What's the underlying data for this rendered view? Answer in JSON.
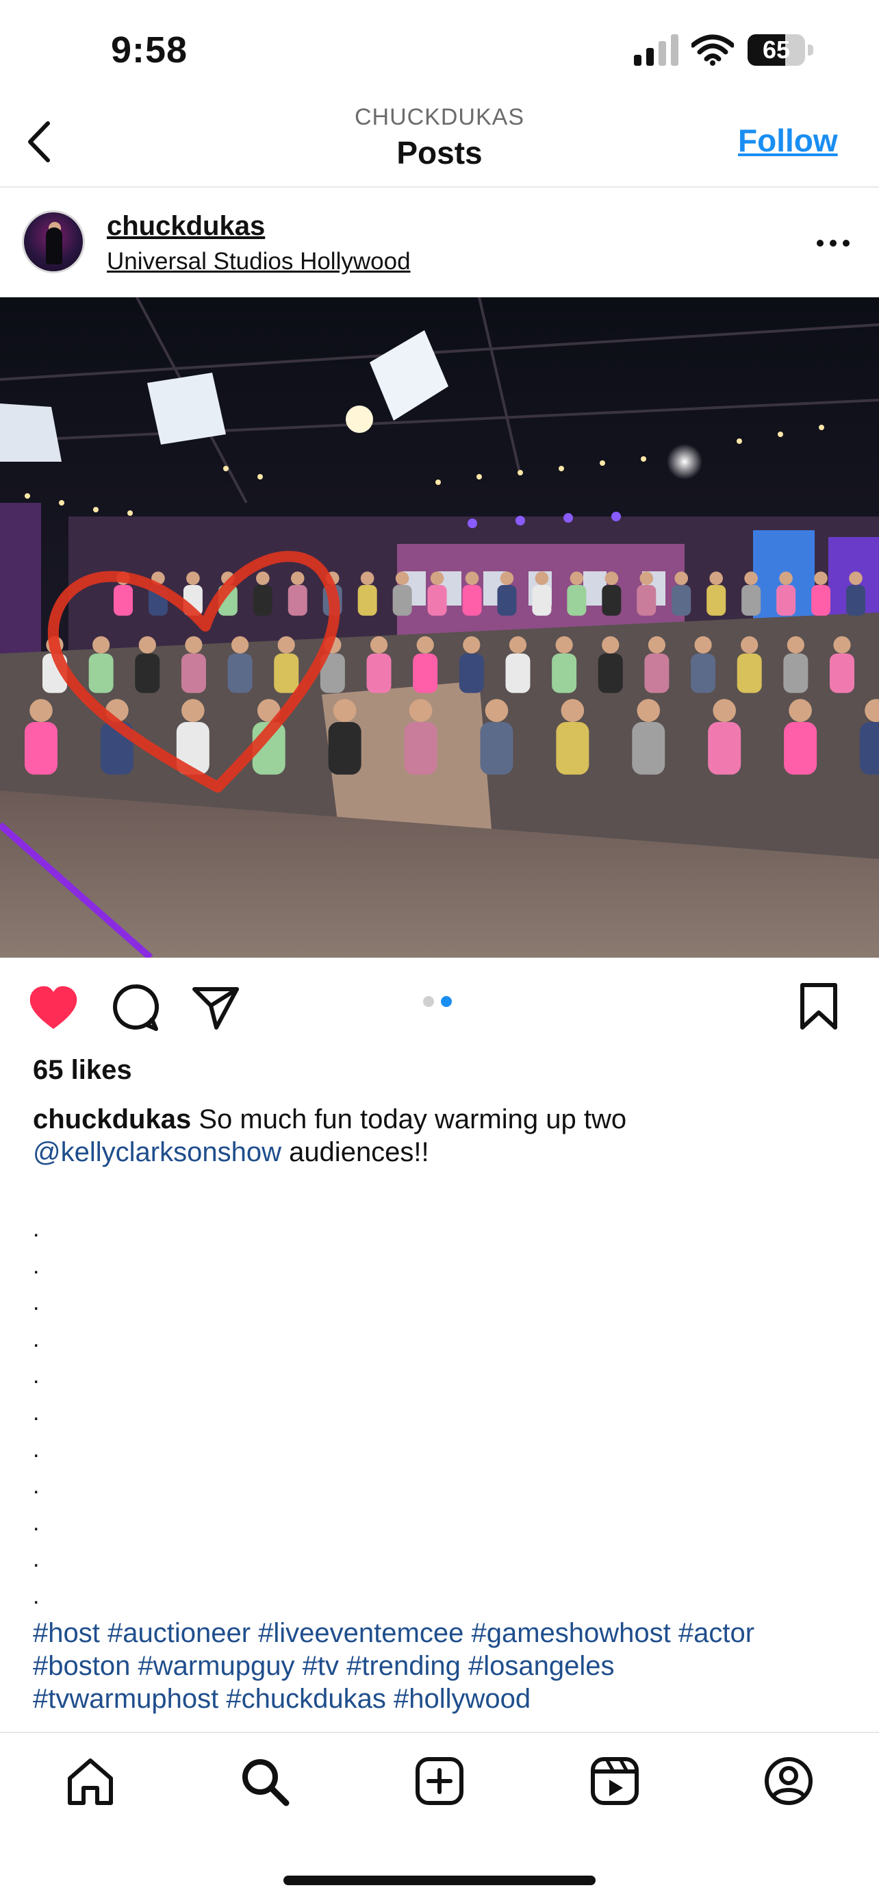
{
  "status": {
    "time": "9:58",
    "battery": "65",
    "battery_level": 0.65
  },
  "header": {
    "username": "CHUCKDUKAS",
    "title": "Posts",
    "follow_label": "Follow"
  },
  "post": {
    "username": "chuckdukas",
    "location": "Universal Studios Hollywood",
    "likes": "65 likes",
    "caption_user": "chuckdukas",
    "caption_text": " So much fun today warming up two",
    "mention": "@kellyclarksonshow",
    "caption_after": " audiences!!",
    "periods": [
      ".",
      ".",
      ".",
      ".",
      ".",
      ".",
      ".",
      ".",
      ".",
      ".",
      "."
    ],
    "hashtags": [
      "#host",
      "#auctioneer",
      "#liveeventemcee",
      "#gameshowhost",
      "#actor",
      "#boston",
      "#warmupguy",
      "#tv",
      "#trending",
      "#losangeles",
      "#tvwarmuphost",
      "#chuckdukas",
      "#hollywood"
    ],
    "carousel": {
      "count": 2,
      "active": 2
    }
  },
  "icons": {
    "back": "chevron-left-icon",
    "more": "more-horizontal-icon",
    "like": "heart-icon",
    "comment": "comment-icon",
    "share": "paper-plane-icon",
    "save": "bookmark-icon",
    "nav": [
      "home-icon",
      "search-icon",
      "create-icon",
      "reels-icon",
      "profile-icon"
    ]
  },
  "colors": {
    "like": "#ff2d55",
    "link": "#1a8ef2",
    "hashtag": "#1f4e8c",
    "carousel_active": "#1a8ef2",
    "carousel_inactive": "#d0d0d0"
  }
}
